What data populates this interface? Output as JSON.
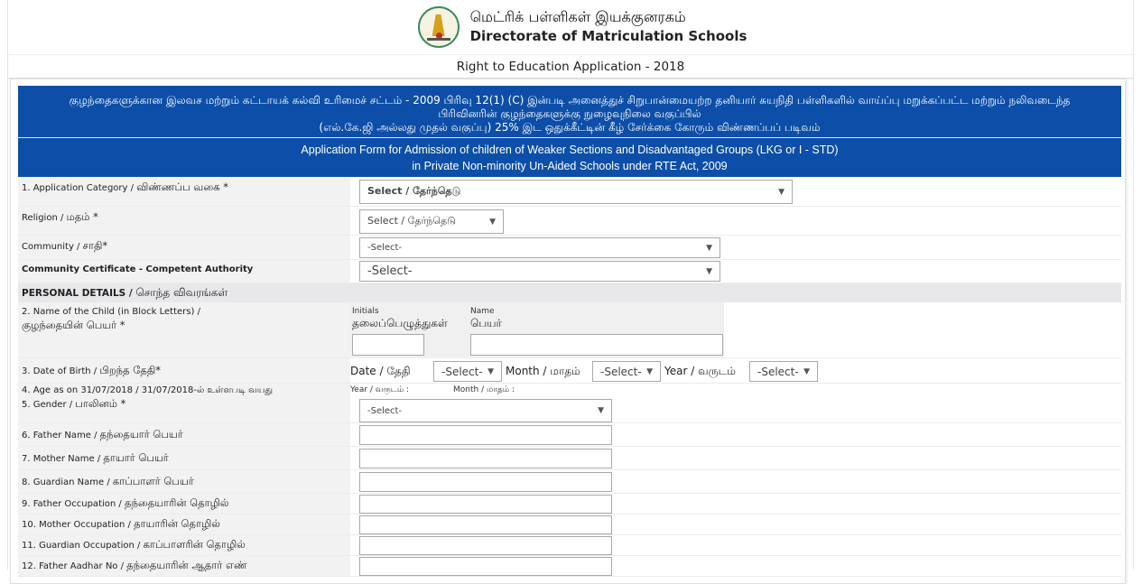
{
  "header": {
    "logo_icon": "tamil-nadu-emblem-icon",
    "title_ta": "மெட்ரிக் பள்ளிகள் இயக்குனரகம்",
    "title_en": "Directorate of Matriculation Schools",
    "subtitle": "Right to Education Application - 2018"
  },
  "banner": {
    "ta_line1": "குழந்தைகளுக்கான இலவச மற்றும் கட்டாயக் கல்வி உரிமைச் சட்டம் - 2009 பிரிவு 12(1) (C) இன்படி அனைத்துச் சிறுபான்மையற்ற தனியார் சுயநிதி பள்ளிகளில் வாய்ப்பு மறுக்கப்பட்ட மற்றும் நலிவடைந்த",
    "ta_line2": "பிரிவினரின் குழந்தைகளுக்கு நுழைவுநிலை வகுப்பில்",
    "ta_line3": "(எல்.கே.ஜி அல்லது முதல் வகுப்பு) 25% இட ஒதுக்கீட்டின் கீழ் சேர்க்கை கோரும் விண்ணப்பப் படிவம்",
    "en_line1": "Application Form for Admission of children of Weaker Sections and Disadvantaged Groups (LKG or I - STD)",
    "en_line2": "in Private Non-minority Un-Aided Schools under RTE Act, 2009"
  },
  "form": {
    "application_category": {
      "label_en": "1. Application Category / ",
      "label_ta": "விண்ணப்ப வகை *",
      "value": "Select / தேர்ந்தெடு"
    },
    "religion": {
      "label_en": "Religion / ",
      "label_ta": "மதம் *",
      "value": "Select / தேர்ந்தெடு"
    },
    "community": {
      "label_en": "Community / ",
      "label_ta": "சாதி*",
      "value": "-Select-"
    },
    "community_certificate": {
      "label": "Community Certificate - Competent Authority",
      "value": "-Select-"
    },
    "personal_section": {
      "label_en": "PERSONAL DETAILS / ",
      "label_ta": "சொந்த விவரங்கள்"
    },
    "child_name": {
      "label_en": "2. Name of the Child (in Block Letters) /",
      "label_ta": "குழந்தையின் பெயர் *",
      "initials_label_en": "Initials",
      "initials_label_ta": "தலைப்பெழுத்துகள்",
      "name_label_en": "Name",
      "name_label_ta": "பெயர்",
      "initials_value": "",
      "name_value": ""
    },
    "dob": {
      "label_en": "3. Date of Birth / ",
      "label_ta": "பிறந்த தேதி*",
      "date_label": "Date / தேதி",
      "date_value": "-Select-",
      "month_label": "Month / மாதம்",
      "month_value": "-Select-",
      "year_label": "Year / வருடம்",
      "year_value": "-Select-"
    },
    "age": {
      "label": "4. Age as on 31/07/2018 /  31/07/2018-ல் உள்ளபடி வயது",
      "year_label": "Year / வருடம் :",
      "month_label": "Month / மாதம் :"
    },
    "gender": {
      "label_en": "5. Gender / ",
      "label_ta": "பாலினம் *",
      "value": "-Select-"
    },
    "text_fields": [
      {
        "label_en": "6. Father Name  / ",
        "label_ta": "தந்தையார் பெயர்",
        "value": ""
      },
      {
        "label_en": "7. Mother Name  / ",
        "label_ta": "தாயார் பெயர்",
        "value": ""
      },
      {
        "label_en": "8. Guardian Name  / ",
        "label_ta": "காப்பாளர் பெயர்",
        "value": ""
      },
      {
        "label_en": "9. Father Occupation  / ",
        "label_ta": "தந்தையாரின் தொழில்",
        "value": ""
      },
      {
        "label_en": "10. Mother Occupation  / ",
        "label_ta": "தாயாரின் தொழில்",
        "value": ""
      },
      {
        "label_en": "11. Guardian Occupation  / ",
        "label_ta": "காப்பாளரின் தொழில்",
        "value": ""
      },
      {
        "label_en": "12. Father Aadhar No  / ",
        "label_ta": "தந்தையாரின் ஆதார் எண்",
        "value": ""
      }
    ]
  },
  "colors": {
    "banner_blue": "#0d4fa8",
    "label_bg": "#f2f2f2",
    "section_bg": "#e8e8ea"
  }
}
